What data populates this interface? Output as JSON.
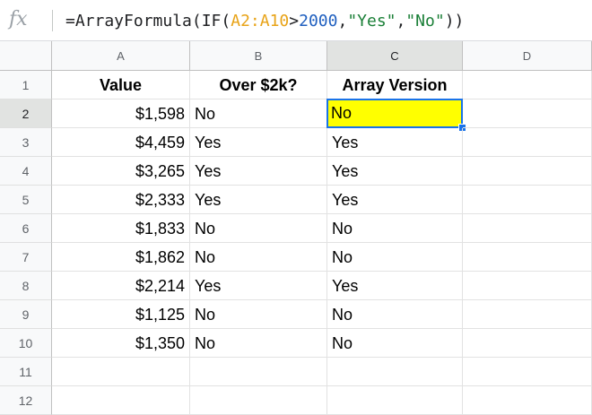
{
  "formula_bar": {
    "fx_icon": "fx-icon",
    "formula_parts": [
      {
        "text": "=ArrayFormula(IF(",
        "kind": "plain"
      },
      {
        "text": "A2:A10",
        "kind": "range"
      },
      {
        "text": ">",
        "kind": "plain"
      },
      {
        "text": "2000",
        "kind": "num"
      },
      {
        "text": ",",
        "kind": "plain"
      },
      {
        "text": "\"Yes\"",
        "kind": "str"
      },
      {
        "text": ",",
        "kind": "plain"
      },
      {
        "text": "\"No\"",
        "kind": "str"
      },
      {
        "text": "))",
        "kind": "plain"
      }
    ]
  },
  "sheet": {
    "columns": [
      "A",
      "B",
      "C",
      "D"
    ],
    "row_numbers": [
      "1",
      "2",
      "3",
      "4",
      "5",
      "6",
      "7",
      "8",
      "9",
      "10",
      "11",
      "12"
    ],
    "active_column": "C",
    "active_row": "2",
    "selected_cell": "C2",
    "selection_color": "#ffff00",
    "rows": [
      [
        "Value",
        "Over $2k?",
        "Array Version",
        ""
      ],
      [
        "$1,598",
        "No",
        "No",
        ""
      ],
      [
        "$4,459",
        "Yes",
        "Yes",
        ""
      ],
      [
        "$3,265",
        "Yes",
        "Yes",
        ""
      ],
      [
        "$2,333",
        "Yes",
        "Yes",
        ""
      ],
      [
        "$1,833",
        "No",
        "No",
        ""
      ],
      [
        "$1,862",
        "No",
        "No",
        ""
      ],
      [
        "$2,214",
        "Yes",
        "Yes",
        ""
      ],
      [
        "$1,125",
        "No",
        "No",
        ""
      ],
      [
        "$1,350",
        "No",
        "No",
        ""
      ],
      [
        "",
        "",
        "",
        ""
      ],
      [
        "",
        "",
        "",
        ""
      ]
    ]
  }
}
